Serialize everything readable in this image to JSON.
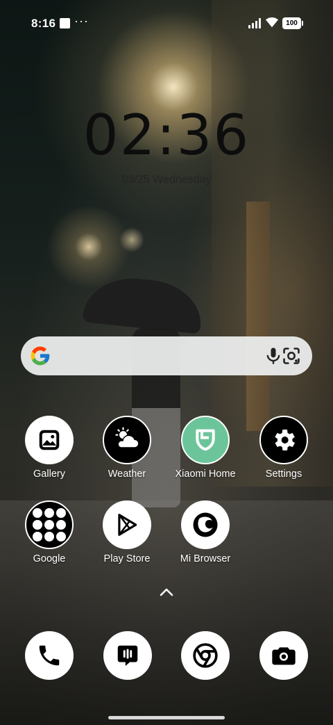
{
  "status_bar": {
    "time": "8:16",
    "more_indicator": "···",
    "battery": "100"
  },
  "clock": {
    "time": "02:36",
    "date": "03/25 Wednesday"
  },
  "search": {
    "engine_icon": "google-g-icon",
    "voice_icon": "mic-icon",
    "lens_icon": "lens-icon"
  },
  "apps": [
    {
      "label": "Gallery",
      "icon": "gallery-icon"
    },
    {
      "label": "Weather",
      "icon": "weather-icon"
    },
    {
      "label": "Xiaomi Home",
      "icon": "xiaomi-home-icon"
    },
    {
      "label": "Settings",
      "icon": "gear-icon"
    },
    {
      "label": "Google",
      "icon": "google-folder-icon"
    },
    {
      "label": "Play Store",
      "icon": "play-store-icon"
    },
    {
      "label": "Mi Browser",
      "icon": "mi-browser-icon"
    }
  ],
  "dock": [
    {
      "icon": "phone-icon"
    },
    {
      "icon": "messages-icon"
    },
    {
      "icon": "chrome-icon"
    },
    {
      "icon": "camera-icon"
    }
  ],
  "colors": {
    "xiaomi_home_green": "#6cc59a",
    "search_bg": "#eef0f0"
  }
}
